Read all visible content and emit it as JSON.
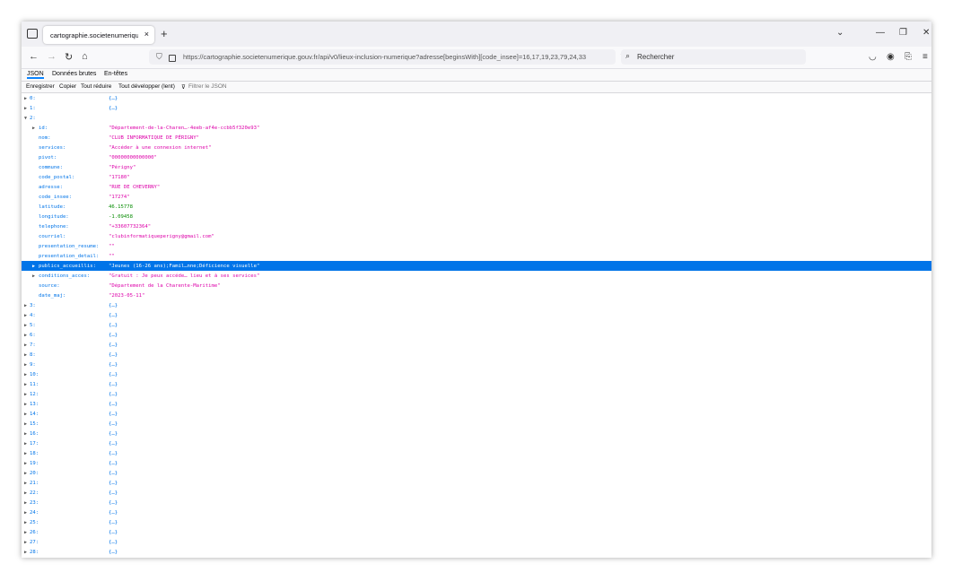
{
  "browser": {
    "tab_title": "cartographie.societenumerique.gou",
    "tab_close": "×",
    "new_tab": "+",
    "url": "https://cartographie.societenumerique.gouv.fr/api/v0/lieux-inclusion-numerique?adresse[beginsWith][code_insee]=16,17,19,23,79,24,33",
    "search_placeholder": "Rechercher",
    "win_controls": [
      "⌄",
      "—",
      "❐",
      "✕"
    ]
  },
  "json_viewer": {
    "tabs": [
      "JSON",
      "Données brutes",
      "En-têtes"
    ],
    "toolbar": [
      "Enregistrer",
      "Copier",
      "Tout réduire",
      "Tout développer (lent)"
    ],
    "filter_placeholder": "Filtrer le JSON"
  },
  "rows": [
    {
      "key": "0:",
      "value": "{…}",
      "type": "obj",
      "indent": 0,
      "twisty": "▶"
    },
    {
      "key": "1:",
      "value": "{…}",
      "type": "obj",
      "indent": 0,
      "twisty": "▶"
    },
    {
      "key": "2:",
      "value": "",
      "type": "obj",
      "indent": 0,
      "twisty": "▼"
    },
    {
      "key": "id:",
      "value": "\"Département-de-la-Charen…-4eeb-af4e-ccbb5f320e93\"",
      "type": "str",
      "indent": 1,
      "twisty": "▶"
    },
    {
      "key": "nom:",
      "value": "\"CLUB INFORMATIQUE DE PÉRIGNY\"",
      "type": "str",
      "indent": 1,
      "twisty": ""
    },
    {
      "key": "services:",
      "value": "\"Accéder à une connexion internet\"",
      "type": "str",
      "indent": 1,
      "twisty": ""
    },
    {
      "key": "pivot:",
      "value": "\"00000000000000\"",
      "type": "str",
      "indent": 1,
      "twisty": ""
    },
    {
      "key": "commune:",
      "value": "\"Périgny\"",
      "type": "str",
      "indent": 1,
      "twisty": ""
    },
    {
      "key": "code_postal:",
      "value": "\"17180\"",
      "type": "str",
      "indent": 1,
      "twisty": ""
    },
    {
      "key": "adresse:",
      "value": "\"RUE DE CHEVERNY\"",
      "type": "str",
      "indent": 1,
      "twisty": ""
    },
    {
      "key": "code_insee:",
      "value": "\"17274\"",
      "type": "str",
      "indent": 1,
      "twisty": ""
    },
    {
      "key": "latitude:",
      "value": "46.15778",
      "type": "num",
      "indent": 1,
      "twisty": ""
    },
    {
      "key": "longitude:",
      "value": "-1.09458",
      "type": "num",
      "indent": 1,
      "twisty": ""
    },
    {
      "key": "telephone:",
      "value": "\"+33607732364\"",
      "type": "str",
      "indent": 1,
      "twisty": ""
    },
    {
      "key": "courriel:",
      "value": "\"clubinformatiqueperigny@gmail.com\"",
      "type": "str",
      "indent": 1,
      "twisty": ""
    },
    {
      "key": "presentation_resume:",
      "value": "\"\"",
      "type": "str",
      "indent": 1,
      "twisty": ""
    },
    {
      "key": "presentation_detail:",
      "value": "\"\"",
      "type": "str",
      "indent": 1,
      "twisty": ""
    },
    {
      "key": "publics_accueillis:",
      "value": "\"Jeunes (16-26 ans);Famil…nne;Déficience visuelle\"",
      "type": "str",
      "indent": 1,
      "twisty": "▶",
      "selected": true
    },
    {
      "key": "conditions_acces:",
      "value": "\"Gratuit : Je peux accéde… lieu et à ses services\"",
      "type": "str",
      "indent": 1,
      "twisty": "▶"
    },
    {
      "key": "source:",
      "value": "\"Département de la Charente-Maritime\"",
      "type": "str",
      "indent": 1,
      "twisty": ""
    },
    {
      "key": "date_maj:",
      "value": "\"2023-05-11\"",
      "type": "str",
      "indent": 1,
      "twisty": ""
    },
    {
      "key": "3:",
      "value": "{…}",
      "type": "obj",
      "indent": 0,
      "twisty": "▶"
    },
    {
      "key": "4:",
      "value": "{…}",
      "type": "obj",
      "indent": 0,
      "twisty": "▶"
    },
    {
      "key": "5:",
      "value": "{…}",
      "type": "obj",
      "indent": 0,
      "twisty": "▶"
    },
    {
      "key": "6:",
      "value": "{…}",
      "type": "obj",
      "indent": 0,
      "twisty": "▶"
    },
    {
      "key": "7:",
      "value": "{…}",
      "type": "obj",
      "indent": 0,
      "twisty": "▶"
    },
    {
      "key": "8:",
      "value": "{…}",
      "type": "obj",
      "indent": 0,
      "twisty": "▶"
    },
    {
      "key": "9:",
      "value": "{…}",
      "type": "obj",
      "indent": 0,
      "twisty": "▶"
    },
    {
      "key": "10:",
      "value": "{…}",
      "type": "obj",
      "indent": 0,
      "twisty": "▶"
    },
    {
      "key": "11:",
      "value": "{…}",
      "type": "obj",
      "indent": 0,
      "twisty": "▶"
    },
    {
      "key": "12:",
      "value": "{…}",
      "type": "obj",
      "indent": 0,
      "twisty": "▶"
    },
    {
      "key": "13:",
      "value": "{…}",
      "type": "obj",
      "indent": 0,
      "twisty": "▶"
    },
    {
      "key": "14:",
      "value": "{…}",
      "type": "obj",
      "indent": 0,
      "twisty": "▶"
    },
    {
      "key": "15:",
      "value": "{…}",
      "type": "obj",
      "indent": 0,
      "twisty": "▶"
    },
    {
      "key": "16:",
      "value": "{…}",
      "type": "obj",
      "indent": 0,
      "twisty": "▶"
    },
    {
      "key": "17:",
      "value": "{…}",
      "type": "obj",
      "indent": 0,
      "twisty": "▶"
    },
    {
      "key": "18:",
      "value": "{…}",
      "type": "obj",
      "indent": 0,
      "twisty": "▶"
    },
    {
      "key": "19:",
      "value": "{…}",
      "type": "obj",
      "indent": 0,
      "twisty": "▶"
    },
    {
      "key": "20:",
      "value": "{…}",
      "type": "obj",
      "indent": 0,
      "twisty": "▶"
    },
    {
      "key": "21:",
      "value": "{…}",
      "type": "obj",
      "indent": 0,
      "twisty": "▶"
    },
    {
      "key": "22:",
      "value": "{…}",
      "type": "obj",
      "indent": 0,
      "twisty": "▶"
    },
    {
      "key": "23:",
      "value": "{…}",
      "type": "obj",
      "indent": 0,
      "twisty": "▶"
    },
    {
      "key": "24:",
      "value": "{…}",
      "type": "obj",
      "indent": 0,
      "twisty": "▶"
    },
    {
      "key": "25:",
      "value": "{…}",
      "type": "obj",
      "indent": 0,
      "twisty": "▶"
    },
    {
      "key": "26:",
      "value": "{…}",
      "type": "obj",
      "indent": 0,
      "twisty": "▶"
    },
    {
      "key": "27:",
      "value": "{…}",
      "type": "obj",
      "indent": 0,
      "twisty": "▶"
    },
    {
      "key": "28:",
      "value": "{…}",
      "type": "obj",
      "indent": 0,
      "twisty": "▶"
    }
  ]
}
